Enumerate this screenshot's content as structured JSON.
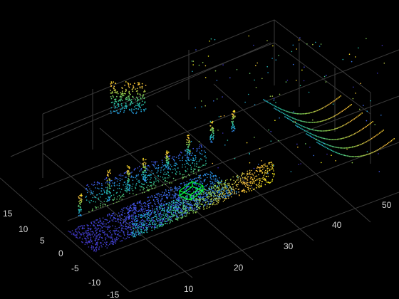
{
  "chart_data": {
    "type": "scatter",
    "title": "",
    "xlabel": "",
    "ylabel": "",
    "zlabel": "",
    "grid": true,
    "background": "#000000",
    "colormap": "parula",
    "box_color": "#00ff33",
    "x_ticks": [
      "10",
      "20",
      "30",
      "40",
      "50"
    ],
    "y_ticks": [
      "15",
      "10",
      "5",
      "0",
      "-5",
      "-10",
      "-15"
    ],
    "xlim": [
      5,
      55
    ],
    "ylim": [
      -15,
      18
    ],
    "point_cloud_description_only": false
  }
}
